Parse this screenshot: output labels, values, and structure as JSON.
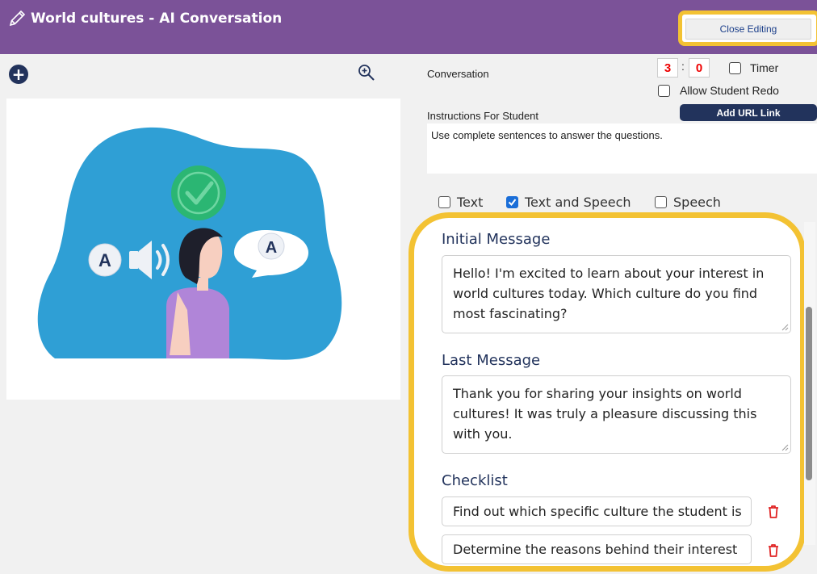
{
  "header": {
    "title": "World cultures - AI Conversation",
    "close_label": "Close Editing"
  },
  "settings": {
    "conversation_label": "Conversation",
    "minutes": "3",
    "seconds": "0",
    "timer_label": "Timer",
    "redo_label": "Allow Student Redo",
    "instructions_label": "Instructions For Student",
    "add_url_label": "Add URL Link",
    "instructions_text": "Use complete sentences to answer the questions."
  },
  "modes": [
    {
      "label": "Text",
      "checked": false
    },
    {
      "label": "Text and Speech",
      "checked": true
    },
    {
      "label": "Speech",
      "checked": false
    }
  ],
  "editor": {
    "initial_label": "Initial Message",
    "initial_text": "Hello! I'm excited to learn about your interest in world cultures today. Which culture do you find most fascinating?",
    "last_label": "Last Message",
    "last_text": "Thank you for sharing your insights on world cultures! It was truly a pleasure discussing this with you.",
    "checklist_label": "Checklist",
    "checklist": [
      "Find out which specific culture the student is",
      "Determine the reasons behind their interest"
    ]
  },
  "illustration": {
    "badge_letter": "A"
  },
  "colors": {
    "header": "#7b5298",
    "highlight": "#f3c233",
    "navy": "#22335c",
    "timer_digits": "#e00000",
    "checkbox_on": "#1a6ed8"
  }
}
